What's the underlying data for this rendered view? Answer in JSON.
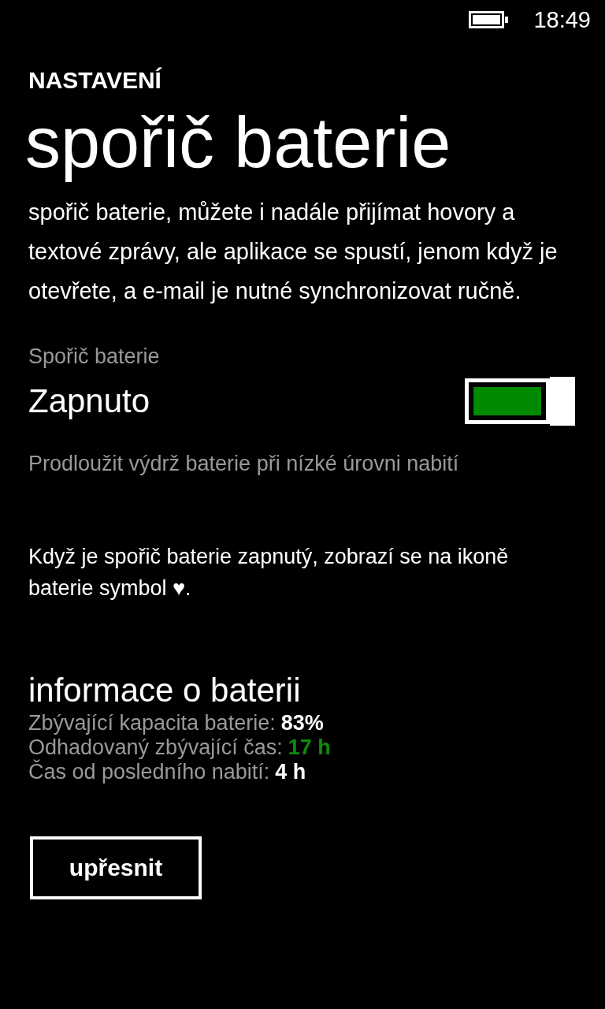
{
  "status_bar": {
    "time": "18:49"
  },
  "header": {
    "app_title": "NASTAVENÍ",
    "page_title": "spořič baterie"
  },
  "intro": "spořič baterie, můžete i nadále přijímat hovory a textové zprávy, ale aplikace se spustí, jenom když je otevřete, a e-mail je nutné synchronizovat ručně.",
  "toggle": {
    "label": "Spořič baterie",
    "state_text": "Zapnuto",
    "on": true,
    "description": "Prodloužit výdrž baterie při nízké úrovni nabití"
  },
  "note": "Když je spořič baterie zapnutý, zobrazí se na ikoně baterie symbol ♥.",
  "info": {
    "title": "informace o baterii",
    "rows": [
      {
        "label": "Zbývající kapacita baterie:",
        "value": "83%",
        "highlight": false
      },
      {
        "label": "Odhadovaný zbývající čas:",
        "value": "17 h",
        "highlight": true
      },
      {
        "label": "Čas od posledního nabití:",
        "value": "4 h",
        "highlight": false
      }
    ]
  },
  "button": "upřesnit"
}
